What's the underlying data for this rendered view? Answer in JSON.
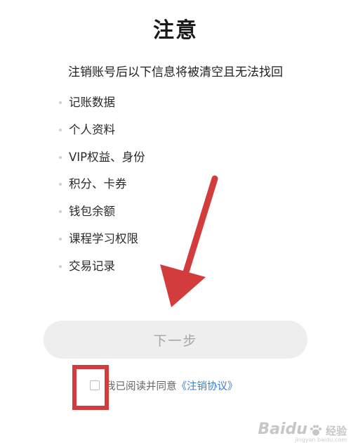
{
  "header": {
    "title": "注意"
  },
  "notice": {
    "subtitle": "注销账号后以下信息将被清空且无法找回",
    "items": [
      "记账数据",
      "个人资料",
      "VIP权益、身份",
      "积分、卡券",
      "钱包余额",
      "课程学习权限",
      "交易记录"
    ]
  },
  "actions": {
    "next_label": "下一步"
  },
  "agreement": {
    "checked": false,
    "text": "我已阅读并同意",
    "link_text": "《注销协议》"
  },
  "annotation": {
    "color": "#d33c3c"
  },
  "watermark": {
    "logo": "Baidu",
    "brand": "经验",
    "url": "jingyan.baidu.com"
  },
  "colors": {
    "link": "#3d7fc2",
    "button_bg": "#eeeeee",
    "button_text": "#a6a6a6"
  }
}
